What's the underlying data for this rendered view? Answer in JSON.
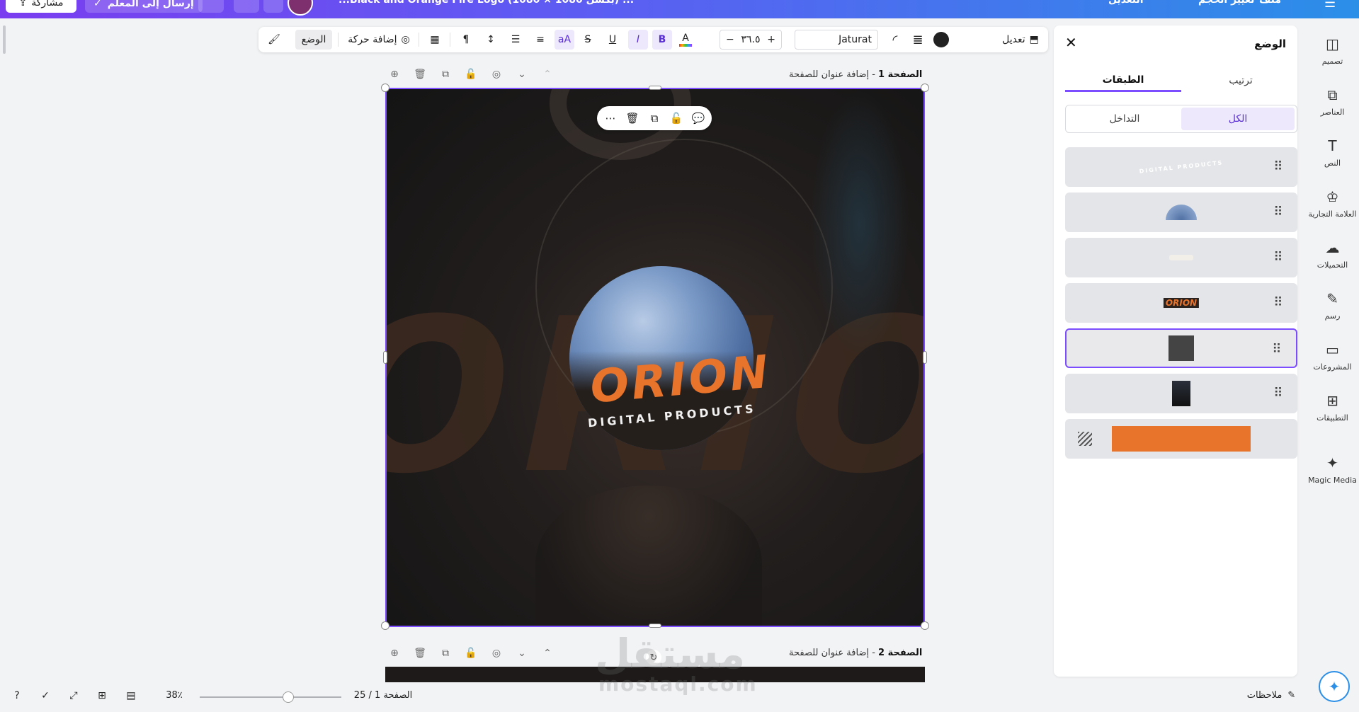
{
  "topbar": {
    "share_label": "مشاركة",
    "send_label": "إرسال إلى المعلم",
    "document_title": "...Black and Orange Fire Logo (1080 × 1080 بكسل) ...",
    "resize_label": "تغيير الحجم",
    "edit_label": "التعديل",
    "file_label": "ملف"
  },
  "toolbar": {
    "position_label": "الوضع",
    "animate_label": "إضافة حركة",
    "font_name": "Jaturat",
    "font_size": "٣٦.٥",
    "minus": "−",
    "plus": "+",
    "edit_label": "تعديل",
    "case_label": "aA",
    "bold": "B",
    "italic": "I",
    "underline": "U",
    "strike": "S",
    "color_letter": "A"
  },
  "page1": {
    "header_prefix": "الصفحة 1",
    "header_suffix": " - إضافة عنوان للصفحة"
  },
  "page2": {
    "header_prefix": "الصفحة 2",
    "header_suffix": " - إضافة عنوان للصفحة"
  },
  "canvas": {
    "bg_text": "ORION",
    "logo_name": "ORION",
    "logo_sub": "DIGITAL PRODUCTS",
    "orange": "#e8732a"
  },
  "panel": {
    "title": "الوضع",
    "tabs": [
      "الطبقات",
      "ترتيب"
    ],
    "segments": [
      "التداخل",
      "الكل"
    ],
    "layers": [
      {
        "name": "text-layer-digital-products",
        "thumb_text": "DIGITAL PRODUCTS"
      },
      {
        "name": "image-layer-planet"
      },
      {
        "name": "image-layer-light-bar"
      },
      {
        "name": "text-layer-orion",
        "thumb_text": "ORION"
      },
      {
        "name": "shape-layer-dark-square",
        "selected": true
      },
      {
        "name": "image-layer-astronaut"
      },
      {
        "name": "background-layer-orange",
        "color": "#e8732a"
      }
    ]
  },
  "rail": {
    "items": [
      "تصميم",
      "العناصر",
      "النص",
      "العلامة التجارية",
      "التحميلات",
      "رسم",
      "المشروعات",
      "التطبيقات",
      "Magic Media"
    ]
  },
  "bottombar": {
    "notes_label": "ملاحظات",
    "page_indicator": "الصفحة 1 / 25",
    "zoom": "38٪",
    "zoom_fraction": 0.38
  },
  "watermark": {
    "arabic": "مستقل",
    "latin": "mostaql.com"
  },
  "colors": {
    "accent": "#7c4dff",
    "brand_orange": "#e8732a"
  }
}
